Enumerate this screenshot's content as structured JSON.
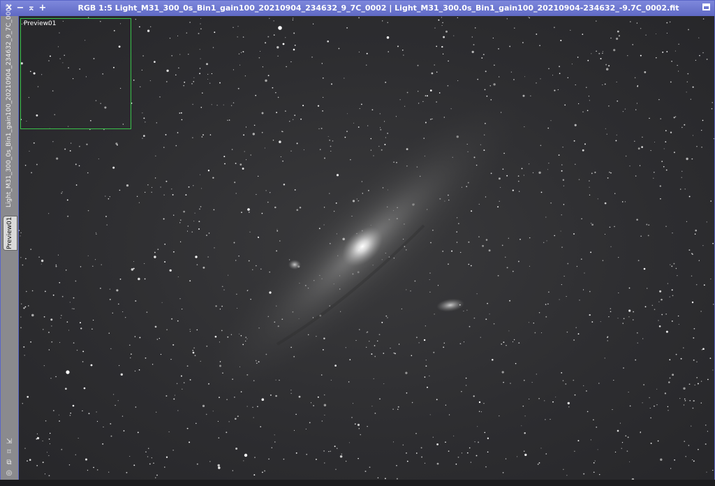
{
  "window": {
    "title": "RGB 1:5 Light_M31_300_0s_Bin1_gain100_20210904_234632_9_7C_0002 | Light_M31_300.0s_Bin1_gain100_20210904-234632_-9.7C_0002.fit",
    "close_glyph": "✕",
    "minimize_glyph": "−",
    "shade_glyph": "⌅",
    "zoom_glyph": "+"
  },
  "sidebar": {
    "main_tab_label": "Light_M31_300_0s_Bin1_gain100_20210904_234632_9_7C_0002",
    "preview_tab_label": "Preview01",
    "icons": [
      {
        "name": "arrow-diagonal-icon",
        "glyph": "⇲"
      },
      {
        "name": "fit-frame-icon",
        "glyph": "⌑"
      },
      {
        "name": "clone-icon",
        "glyph": "⧉"
      },
      {
        "name": "target-icon",
        "glyph": "◎"
      }
    ]
  },
  "image": {
    "preview_label": "Preview01",
    "colors": {
      "background": "#2d2d30",
      "preview_border": "#39c24a",
      "window_frame": "#6b74c9"
    }
  }
}
